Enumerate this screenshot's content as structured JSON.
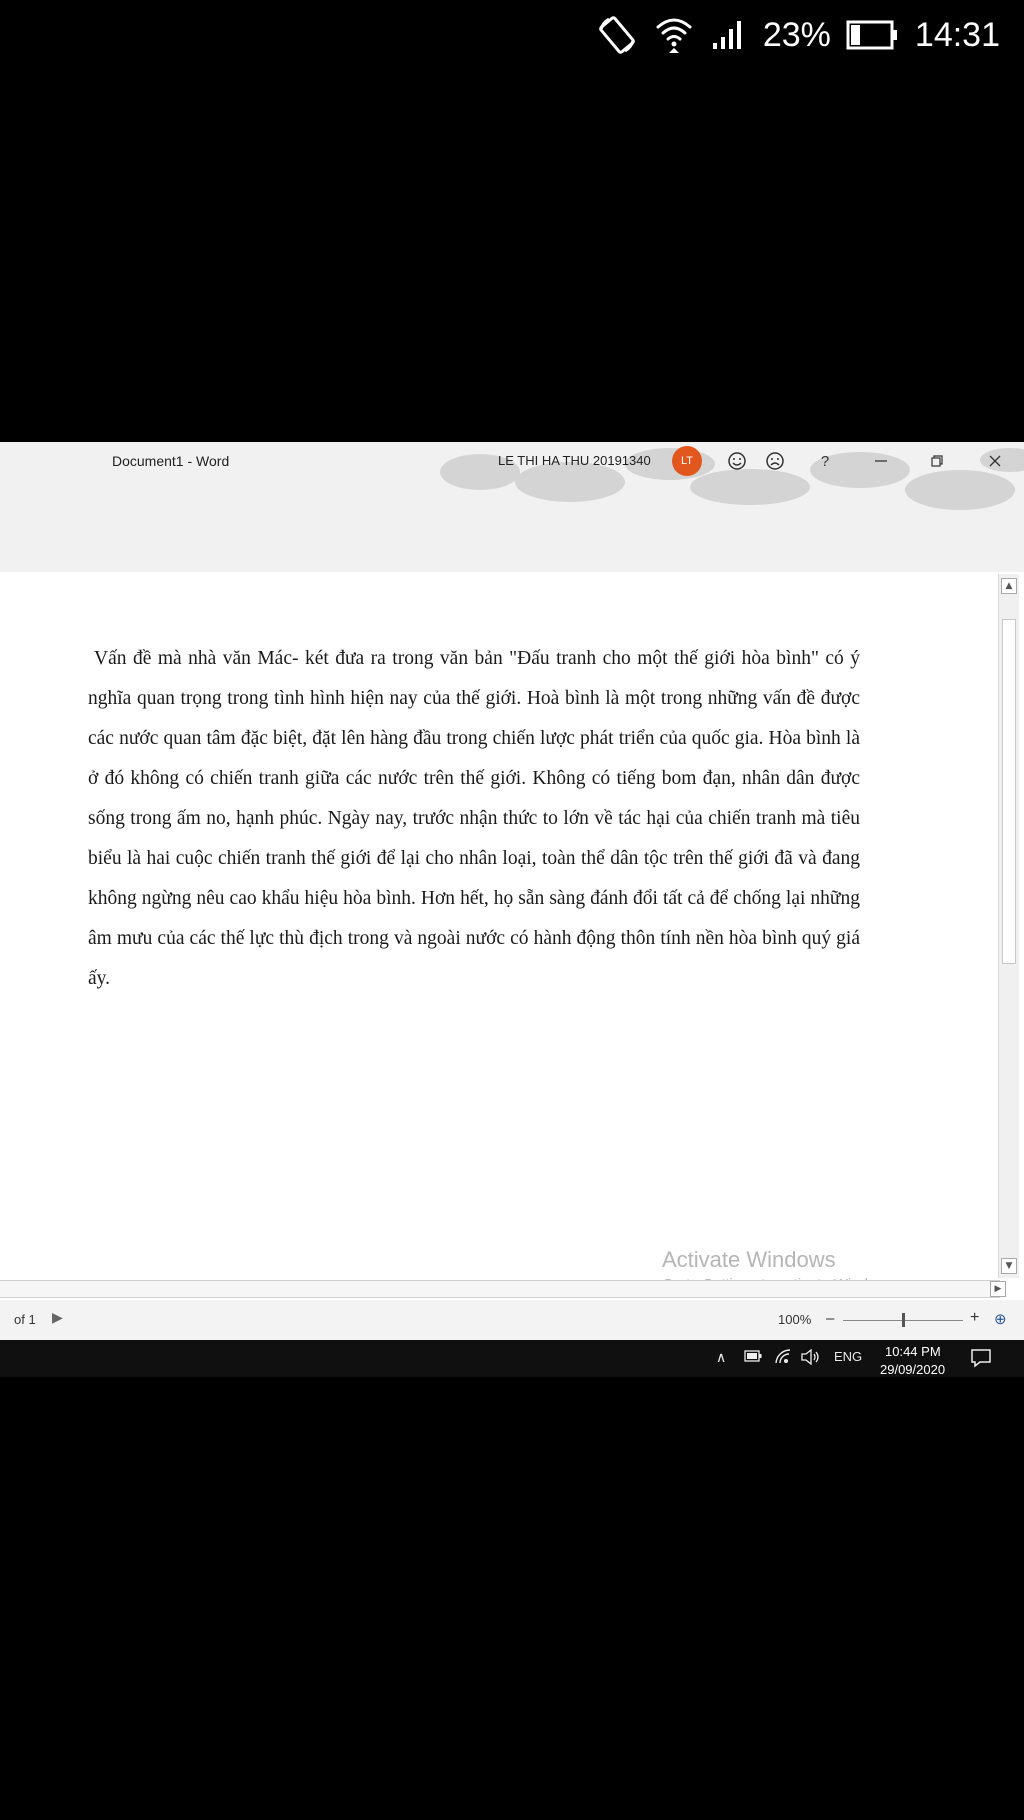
{
  "phone_status": {
    "battery_percent": "23%",
    "time": "14:31",
    "icons": [
      "rotate-icon",
      "wifi-icon",
      "signal-icon",
      "battery-icon"
    ]
  },
  "word": {
    "document_title": "Document1  -  Word",
    "user_name": "LE THI HA THU 20191340",
    "avatar_initials": "LT",
    "help_label": "?",
    "body_text": "Vấn đề mà nhà văn Mác- két đưa ra trong văn bản \"Đấu tranh cho một thế giới hòa bình\" có ý nghĩa quan trọng trong tình hình hiện nay của thế giới. Hoà bình là một trong những vấn đề được các nước quan tâm đặc biệt, đặt lên hàng đầu trong chiến lược phát triển của quốc gia.  Hòa bình là ở đó không có chiến tranh giữa các nước trên thế giới. Không có tiếng bom đạn, nhân dân được sống trong ấm no, hạnh phúc. Ngày nay, trước nhận thức to lớn về tác hại của chiến tranh mà tiêu biểu là hai cuộc chiến tranh thế giới để lại cho nhân loại, toàn thể dân tộc trên thế giới đã và đang không ngừng nêu cao khẩu hiệu hòa bình. Hơn hết, họ sẵn sàng đánh đổi tất cả để chống lại những âm mưu của các thế lực thù địch trong và ngoài nước có hành động thôn tính nền hòa bình quý giá ấy.",
    "page_counter": "of 1",
    "zoom": "100%",
    "zoom_level_percent": 50
  },
  "watermark": {
    "line1": "Activate Windows",
    "line2": "Go to Settings to activate Windows."
  },
  "taskbar": {
    "language": "ENG",
    "clock_time": "10:44 PM",
    "clock_date": "29/09/2020"
  },
  "colors": {
    "avatar": "#e2571d",
    "taskbar": "#101010"
  }
}
